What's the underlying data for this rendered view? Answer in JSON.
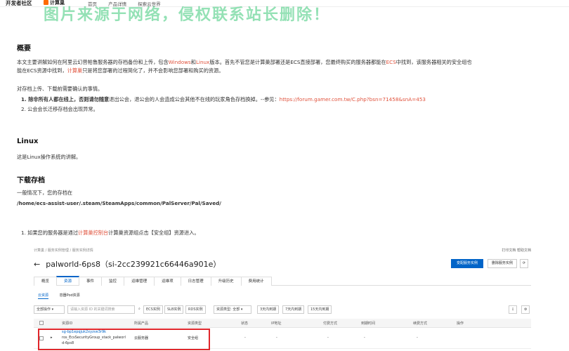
{
  "topbar": {
    "brand": "开发者社区",
    "logo": "计算巢",
    "nav": [
      "首页",
      "产品详情",
      "探索云世界"
    ],
    "watermark": "图片来源于网络，侵权联系站长删除！"
  },
  "article": {
    "overview_heading": "概要",
    "overview_line1_a": "本文主要讲解如何在阿里云幻兽帕鲁服务器的存档备份和上传，包含",
    "overview_line1_windows": "Windows",
    "overview_line1_and": "和",
    "overview_line1_linux": "Linux",
    "overview_line1_b": "版本。首先不管您是计算巢部署还是ECS直接部署，您最终购买的服务器都能在",
    "overview_line1_ecs": "ECS",
    "overview_line1_c": "中找到，该服务器相关的安全组也",
    "overview_line2_a": "能在ECS资源中找到，",
    "overview_line2_link": "计算巢",
    "overview_line2_b": "只是将您部署的过程简化了，并不会影响您部署和购买的资源。",
    "confirm_intro": "对存档上传、下载前需要确认的事情。",
    "item1_bold": "1. 除非所有人都在线上，否则请勿随意",
    "item1_rest": "退出公会，退公会的人会造成公会其他不在线的玩家角色存档换掉。--参见：",
    "item1_url": "https://forum.gamer.com.tw/C.php?bsn=71458&snA=453",
    "item2": "2. 公会会长迁移存档会出现异常。",
    "linux_heading": "Linux",
    "linux_desc": "这是Linux操作系统的讲解。",
    "download_heading": "下载存档",
    "download_desc": "一般情况下，您的存档在",
    "save_path": "/home/ecs-assist-user/.steam/SteamApps/common/PalServer/Pal/Saved/",
    "step1_a": "1. 如果您的服务器是通过",
    "step1_link": "计算巢控制台",
    "step1_b": "计算巢资源组点击【安全组】资源进入。"
  },
  "console": {
    "breadcrumb": "计算巢 / 服务实例管理 / 服务实例详情",
    "right_links": "打印文档  帮助文档",
    "back": "←",
    "title": "palworld-6ps8（si-2cc239921c66446a901e）",
    "btn_change": "变配服务实例",
    "btn_delete": "删除服务实例",
    "tabs": [
      "概览",
      "资源",
      "事件",
      "监控",
      "运维管理",
      "运维项",
      "日志管理",
      "升级历史",
      "费用统计"
    ],
    "subtabs": [
      "云资源",
      "容器Pod资源"
    ],
    "filters": [
      "全部操作 ▾",
      "请输入资源 ID 的关键词搜索",
      "ECS实例",
      "SLB实例",
      "RDS实例",
      "资源类型: 全部 ▾",
      "3天内到期",
      "7天内到期",
      "15天内到期"
    ],
    "headers": [
      "资源ID",
      "所属产品",
      "资源类型",
      "状态",
      "IP地址",
      "付费方式",
      "到期时间",
      "续费方式",
      "操作"
    ],
    "row": {
      "id_line1": "sg-bp1epqjuk2xyzve3r9k",
      "id_line2": "ros_EcsSecurityGroup_stack_palworl",
      "id_line3": "d-6ps8",
      "product": "云服务器",
      "type": "安全组",
      "dash": "-"
    }
  }
}
